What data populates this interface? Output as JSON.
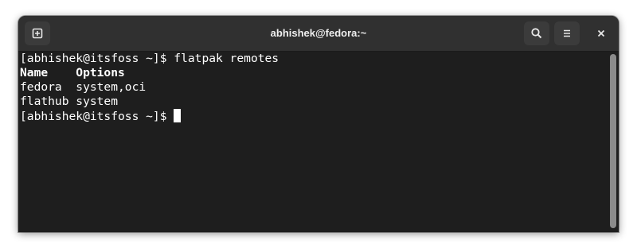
{
  "window": {
    "title": "abhishek@fedora:~"
  },
  "headerbar": {
    "new_tab_icon": "new-tab-icon",
    "search_icon": "search-icon",
    "menu_icon": "hamburger-menu-icon",
    "close_icon": "close-icon"
  },
  "terminal": {
    "lines": [
      {
        "prompt": "[abhishek@itsfoss ~]$ ",
        "text": "flatpak remotes"
      },
      {
        "header": "Name    Options"
      },
      {
        "text": "fedora  system,oci"
      },
      {
        "text": "flathub system"
      },
      {
        "prompt": "[abhishek@itsfoss ~]$ ",
        "text": ""
      }
    ]
  },
  "colors": {
    "background": "#1e1e1e",
    "headerbar": "#303030",
    "foreground": "#ffffff"
  }
}
